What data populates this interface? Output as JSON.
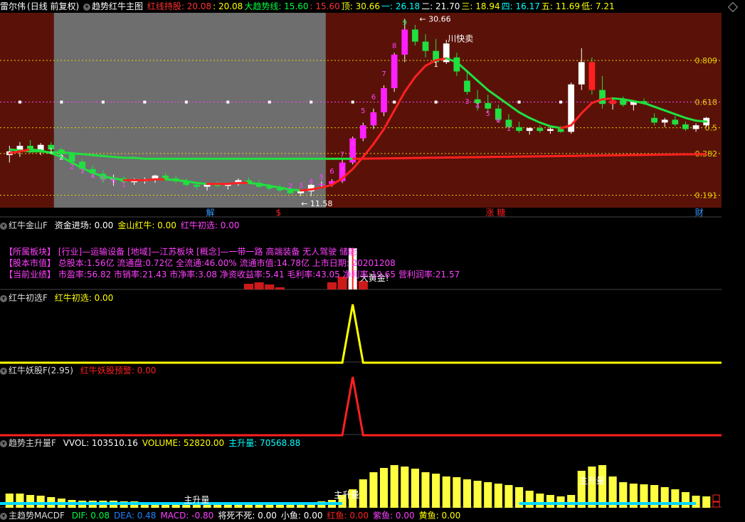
{
  "header": {
    "stock_name": "雷尔伟",
    "period": "(日线 前复权)",
    "indicator_name": "趋势红牛主图",
    "items": [
      {
        "label": "红线持股:",
        "value": "20.08",
        "color": "#ff3030"
      },
      {
        "label": "",
        "value": ": 20.08",
        "color": "#ffff00"
      },
      {
        "label": "大趋势线:",
        "value": "15.60",
        "color": "#00ff40"
      },
      {
        "label": "",
        "value": ": 15.60",
        "color": "#ff3030"
      },
      {
        "label": "顶:",
        "value": "30.66",
        "color": "#ffff00"
      },
      {
        "label": "一:",
        "value": "26.18",
        "color": "#00ffff"
      },
      {
        "label": "二:",
        "value": "21.70",
        "color": "#ffffff"
      },
      {
        "label": "三:",
        "value": "18.94",
        "color": "#ffff00"
      },
      {
        "label": "四:",
        "value": "16.17",
        "color": "#00ffff"
      },
      {
        "label": "五:",
        "value": "11.69",
        "color": "#ffff00"
      },
      {
        "label": "低:",
        "value": "7.21",
        "color": "#ffff00"
      }
    ]
  },
  "main_chart": {
    "fib_labels": [
      "0.809",
      "0.618",
      "0.5",
      "0.382",
      "0.191"
    ],
    "top_label": "30.66",
    "top_label_prefix": "←",
    "low_label": "← 11.58",
    "sell_label": "川快卖",
    "event_markers": [
      "解",
      "$",
      "涨 糖",
      "财"
    ],
    "wave_numbers": [
      "9",
      "8",
      "7",
      "6",
      "5",
      "4",
      "3",
      "2",
      "1",
      "1",
      "2",
      "3",
      "4",
      "5",
      "6",
      "1",
      "2",
      "3",
      "4",
      "5",
      "6",
      "1",
      "2",
      "3",
      "4",
      "5",
      "6",
      "7"
    ]
  },
  "chart_data": [
    {
      "type": "candlestick",
      "title": "趋势红牛主图",
      "ylim": [
        7.21,
        30.66
      ],
      "fib_levels": {
        "0.809": 26.18,
        "0.618": 21.7,
        "0.5": 18.94,
        "0.382": 16.17,
        "0.191": 11.69
      },
      "candles": [
        [
          16.0,
          17.0,
          15.2,
          16.4
        ],
        [
          16.4,
          17.4,
          15.8,
          17.0
        ],
        [
          17.0,
          17.6,
          16.2,
          16.5
        ],
        [
          16.5,
          17.3,
          16.0,
          17.1
        ],
        [
          17.1,
          17.4,
          16.4,
          16.6
        ],
        [
          16.6,
          16.8,
          15.9,
          16.1
        ],
        [
          16.1,
          16.4,
          15.0,
          15.3
        ],
        [
          15.3,
          15.6,
          14.0,
          14.5
        ],
        [
          14.5,
          14.9,
          13.6,
          14.0
        ],
        [
          14.0,
          14.4,
          13.0,
          13.4
        ],
        [
          13.4,
          13.9,
          12.7,
          13.5
        ],
        [
          13.5,
          13.8,
          12.9,
          13.1
        ],
        [
          13.1,
          13.5,
          12.8,
          13.2
        ],
        [
          13.2,
          13.6,
          12.9,
          13.4
        ],
        [
          13.4,
          13.9,
          13.0,
          13.8
        ],
        [
          13.8,
          14.1,
          13.3,
          13.5
        ],
        [
          13.5,
          13.8,
          13.0,
          13.2
        ],
        [
          13.2,
          13.5,
          12.6,
          12.8
        ],
        [
          12.8,
          13.1,
          12.3,
          12.6
        ],
        [
          12.6,
          13.0,
          12.2,
          12.9
        ],
        [
          12.9,
          13.2,
          12.5,
          12.7
        ],
        [
          12.7,
          13.0,
          12.3,
          13.0
        ],
        [
          13.0,
          13.5,
          12.7,
          13.3
        ],
        [
          13.3,
          13.6,
          12.9,
          13.0
        ],
        [
          13.0,
          13.3,
          12.5,
          12.6
        ],
        [
          12.6,
          12.9,
          12.2,
          12.4
        ],
        [
          12.4,
          12.8,
          12.0,
          12.2
        ],
        [
          12.2,
          12.4,
          11.8,
          11.9
        ],
        [
          11.9,
          12.3,
          11.6,
          12.1
        ],
        [
          12.1,
          12.9,
          11.58,
          12.8
        ],
        [
          12.8,
          13.2,
          12.5,
          12.9
        ],
        [
          12.9,
          13.4,
          12.6,
          13.2
        ],
        [
          13.2,
          15.5,
          13.0,
          15.2
        ],
        [
          15.2,
          18.0,
          15.0,
          17.8
        ],
        [
          17.8,
          19.5,
          17.5,
          19.2
        ],
        [
          19.2,
          21.0,
          18.8,
          20.6
        ],
        [
          20.6,
          23.5,
          20.2,
          23.2
        ],
        [
          23.2,
          27.0,
          22.8,
          26.8
        ],
        [
          26.8,
          30.66,
          26.0,
          29.5
        ],
        [
          29.5,
          30.0,
          27.8,
          28.2
        ],
        [
          28.2,
          29.0,
          26.5,
          27.2
        ],
        [
          27.2,
          28.5,
          25.5,
          26.0
        ],
        [
          26.0,
          28.4,
          25.8,
          28.0
        ],
        [
          26.5,
          27.0,
          24.5,
          25.0
        ],
        [
          24.0,
          25.0,
          22.5,
          22.8
        ],
        [
          22.0,
          23.0,
          20.8,
          21.6
        ],
        [
          21.6,
          22.5,
          20.5,
          21.0
        ],
        [
          21.0,
          21.4,
          19.5,
          19.8
        ],
        [
          19.8,
          20.4,
          18.8,
          19.0
        ],
        [
          19.0,
          19.6,
          18.4,
          18.6
        ],
        [
          18.6,
          19.0,
          18.2,
          18.9
        ],
        [
          18.9,
          19.2,
          18.4,
          18.6
        ],
        [
          18.6,
          19.0,
          18.3,
          18.8
        ],
        [
          18.8,
          19.1,
          18.4,
          18.5
        ],
        [
          18.5,
          23.8,
          18.3,
          23.6
        ],
        [
          23.6,
          27.5,
          23.0,
          26.0
        ],
        [
          26.0,
          26.5,
          22.5,
          23.0
        ],
        [
          23.0,
          24.5,
          21.0,
          21.5
        ],
        [
          21.5,
          22.0,
          20.9,
          21.9
        ],
        [
          21.9,
          22.3,
          21.2,
          21.4
        ],
        [
          21.4,
          21.9,
          20.8,
          21.8
        ],
        [
          21.8,
          22.1,
          21.4,
          21.5
        ],
        [
          20.0,
          20.5,
          19.2,
          19.5
        ],
        [
          19.5,
          20.0,
          19.0,
          19.8
        ],
        [
          19.8,
          20.2,
          19.1,
          19.3
        ],
        [
          19.3,
          19.6,
          18.6,
          18.8
        ],
        [
          18.8,
          19.4,
          18.5,
          19.2
        ],
        [
          19.2,
          20.1,
          19.0,
          20.0
        ]
      ],
      "series": [
        {
          "name": "红线持股",
          "color": "#ff2020"
        },
        {
          "name": "大趋势线",
          "color": "#20e040"
        }
      ]
    },
    {
      "type": "bar",
      "title": "红牛金山F",
      "series": [
        {
          "name": "资金进场",
          "value": 0.0
        },
        {
          "name": "金山红牛",
          "value": 0.0
        },
        {
          "name": "红牛初选",
          "value": 0.0
        }
      ]
    },
    {
      "type": "line",
      "title": "红牛初选F",
      "series": [
        {
          "name": "红牛初选",
          "value": 0.0,
          "color": "#ffff00"
        }
      ],
      "peak_index": 33
    },
    {
      "type": "line",
      "title": "红牛妖股F(2.95)",
      "series": [
        {
          "name": "红牛妖股预警",
          "value": 0.0,
          "color": "#ff2020"
        }
      ],
      "peak_index": 33
    },
    {
      "type": "bar",
      "title": "趋势主升量F",
      "series": [
        {
          "name": "VVOL",
          "value": 103510.16
        },
        {
          "name": "VOLUME",
          "value": 52820.0
        },
        {
          "name": "主升量",
          "value": 70568.88
        }
      ],
      "bars": [
        20,
        20,
        18,
        17,
        15,
        13,
        11,
        10,
        10,
        10,
        10,
        9,
        9,
        8,
        8,
        8,
        8,
        8,
        7,
        7,
        7,
        7,
        7,
        7,
        7,
        8,
        8,
        7,
        6,
        7,
        9,
        11,
        18,
        26,
        40,
        50,
        56,
        60,
        58,
        55,
        50,
        48,
        44,
        43,
        40,
        38,
        36,
        34,
        32,
        29,
        24,
        20,
        18,
        16,
        18,
        52,
        58,
        60,
        44,
        36,
        34,
        33,
        32,
        29,
        26,
        22,
        17,
        16
      ]
    },
    {
      "type": "line",
      "title": "主趋势MACDF",
      "series": [
        {
          "name": "DIF",
          "value": 0.08
        },
        {
          "name": "DEA",
          "value": 0.48
        },
        {
          "name": "MACD",
          "value": -0.8
        },
        {
          "name": "将死不死",
          "value": 0.0
        },
        {
          "name": "小鱼",
          "value": 0.0
        },
        {
          "name": "红鱼",
          "value": 0.0
        },
        {
          "name": "紫鱼",
          "value": 0.0
        },
        {
          "name": "黄鱼",
          "value": 0.0
        }
      ]
    }
  ],
  "panels": {
    "p2": {
      "title": "红牛金山F",
      "items": [
        {
          "label": "资金进场:",
          "value": "0.00",
          "color": "#ffffff"
        },
        {
          "label": "金山红牛:",
          "value": "0.00",
          "color": "#ffff00"
        },
        {
          "label": "红牛初选:",
          "value": "0.00",
          "color": "#ff40ff"
        }
      ],
      "info": [
        "【所属板块】 [行业]—运输设备 [地域]—江苏板块 [概念]—一带一路 高端装备 无人驾驶 储能",
        "【股本市值】 总股本:1.56亿 流通盘:0.72亿 全流通:46.00% 流通市值:14.78亿 上市日期: 20201208",
        "【当前业绩】 市盈率:56.82 市销率:21.43 市净率:3.08 净资收益率:5.41 毛利率:43.05 净利率:19.65 营利润率:21.57"
      ],
      "tag": "大黄金!"
    },
    "p3": {
      "title": "红牛初选F",
      "items": [
        {
          "label": "红牛初选:",
          "value": "0.00",
          "color": "#ffff00"
        }
      ]
    },
    "p4": {
      "title": "红牛妖股F(2.95)",
      "items": [
        {
          "label": "红牛妖股预警:",
          "value": "0.00",
          "color": "#ff2020"
        }
      ]
    },
    "p5": {
      "title": "趋势主升量F",
      "items": [
        {
          "label": "VVOL:",
          "value": "103510.16",
          "color": "#ffffff"
        },
        {
          "label": "VOLUME:",
          "value": "52820.00",
          "color": "#ffff00"
        },
        {
          "label": "主升量:",
          "value": "70568.88",
          "color": "#00ffff"
        }
      ],
      "labels": [
        "主升量",
        "主升量",
        "主升量"
      ]
    },
    "p6": {
      "title": "主趋势MACDF",
      "items": [
        {
          "label": "DIF:",
          "value": "0.08",
          "color": "#00ff40"
        },
        {
          "label": "DEA:",
          "value": "0.48",
          "color": "#2080ff"
        },
        {
          "label": "MACD:",
          "value": "-0.80",
          "color": "#ff40ff"
        },
        {
          "label": "将死不死:",
          "value": "0.00",
          "color": "#ffffff"
        },
        {
          "label": "小鱼:",
          "value": "0.00",
          "color": "#ffffff"
        },
        {
          "label": "红鱼:",
          "value": "0.00",
          "color": "#ff2020"
        },
        {
          "label": "紫鱼:",
          "value": "0.00",
          "color": "#ff40ff"
        },
        {
          "label": "黄鱼:",
          "value": "0.00",
          "color": "#ffff00"
        }
      ]
    }
  }
}
